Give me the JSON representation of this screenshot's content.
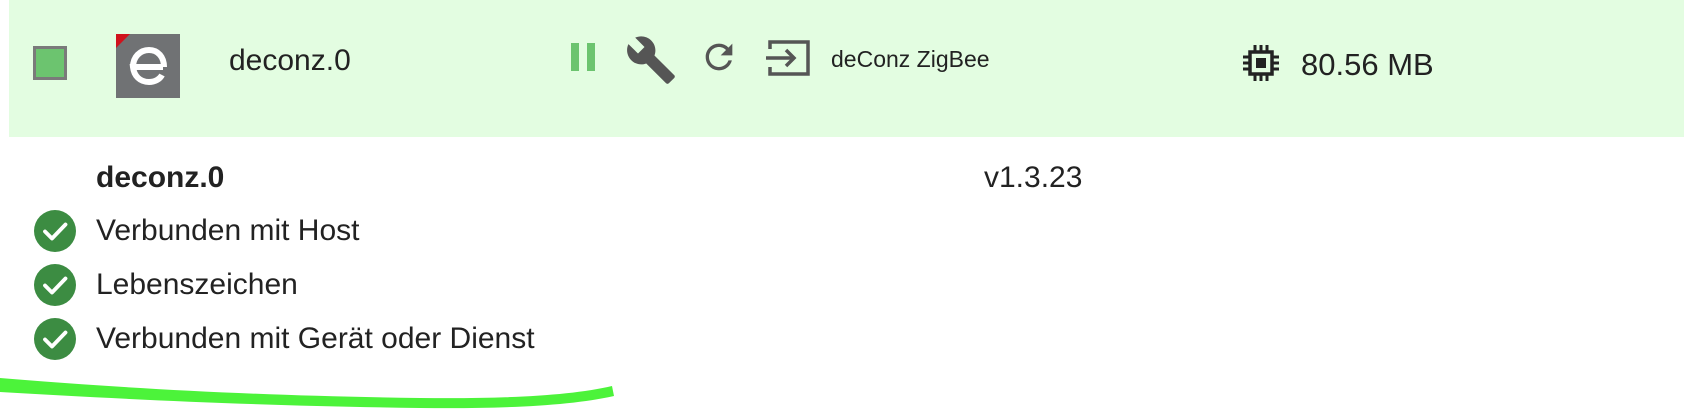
{
  "instance": {
    "name": "deconz.0",
    "title": "deConz ZigBee",
    "ram": "80.56 MB",
    "status_color": "#6cc46f",
    "row_background": "#e3fde1",
    "icons": {
      "status": "status-square-icon",
      "logo": "deconz-adapter-logo",
      "pause": "pause-icon",
      "settings": "wrench-icon",
      "restart": "reload-icon",
      "login": "login-arrow-icon",
      "memory": "chip-icon"
    }
  },
  "details": {
    "name": "deconz.0",
    "version": "v1.3.23",
    "status_items": [
      {
        "label": "Verbunden mit Host",
        "ok": true
      },
      {
        "label": "Lebenszeichen",
        "ok": true
      },
      {
        "label": "Verbunden mit Gerät oder Dienst",
        "ok": true
      }
    ],
    "check_color": "#3c8c42"
  },
  "annotation_color": "#4cf33a"
}
